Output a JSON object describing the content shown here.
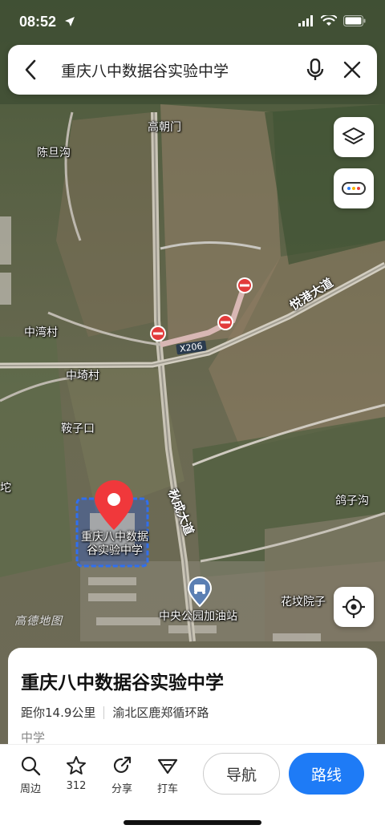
{
  "status_bar": {
    "time": "08:52"
  },
  "search": {
    "query": "重庆八中数据谷实验中学"
  },
  "map": {
    "labels": {
      "gaochaomen": "高朝门",
      "chendangou": "陈旦沟",
      "zhongwancun": "中湾村",
      "zhongqicun": "中埼村",
      "anzikou": "鞍子口",
      "tuo": "坨",
      "gezigou": "鸽子沟",
      "huafenyuanzi": "花坟院子",
      "gas_station": "中央公园加油站"
    },
    "roads": {
      "yuegang": "悦港大道",
      "qiucheng": "秋成大道",
      "x206": "X206"
    },
    "poi_label": "重庆八中数据谷实验中学",
    "watermark": "高德地图"
  },
  "place_card": {
    "title": "重庆八中数据谷实验中学",
    "distance": "距你14.9公里",
    "address": "渝北区鹿郑循环路",
    "category": "中学"
  },
  "actions": {
    "nearby": "周边",
    "favorites_count": "312",
    "share": "分享",
    "taxi": "打车",
    "navigate": "导航",
    "route": "路线"
  },
  "colors": {
    "accent": "#1e7bf6",
    "marker": "#f0383b"
  }
}
